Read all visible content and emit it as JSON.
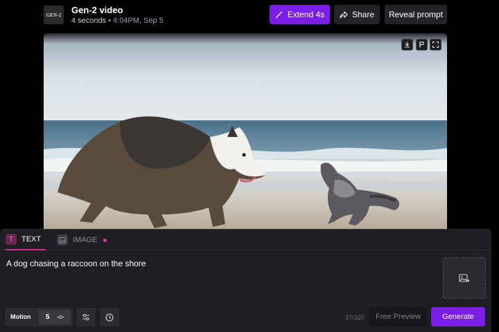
{
  "header": {
    "thumbnail_text": "GEN-2",
    "title": "Gen-2 video",
    "duration": "4 seconds",
    "separator": "•",
    "timestamp": "4:04PM, Sep 5",
    "extend_label": "Extend 4s",
    "share_label": "Share",
    "reveal_label": "Reveal prompt"
  },
  "video": {
    "controls": [
      "download-icon",
      "pin-icon",
      "fullscreen-icon"
    ],
    "scene": "dog-and-raccoon-on-beach"
  },
  "panel": {
    "tabs": [
      {
        "label": "TEXT",
        "icon": "text-icon",
        "active": true
      },
      {
        "label": "IMAGE",
        "icon": "image-icon",
        "active": false
      }
    ],
    "prompt_text": "A dog chasing a raccoon on the shore",
    "motion_label": "Motion",
    "motion_value": "5",
    "char_count": "37/320",
    "free_preview_label": "Free Preview",
    "generate_label": "Generate"
  },
  "colors": {
    "accent": "#7a1de8",
    "tab_indicator": "#c23b8d",
    "panel_bg": "#1e1f23"
  }
}
